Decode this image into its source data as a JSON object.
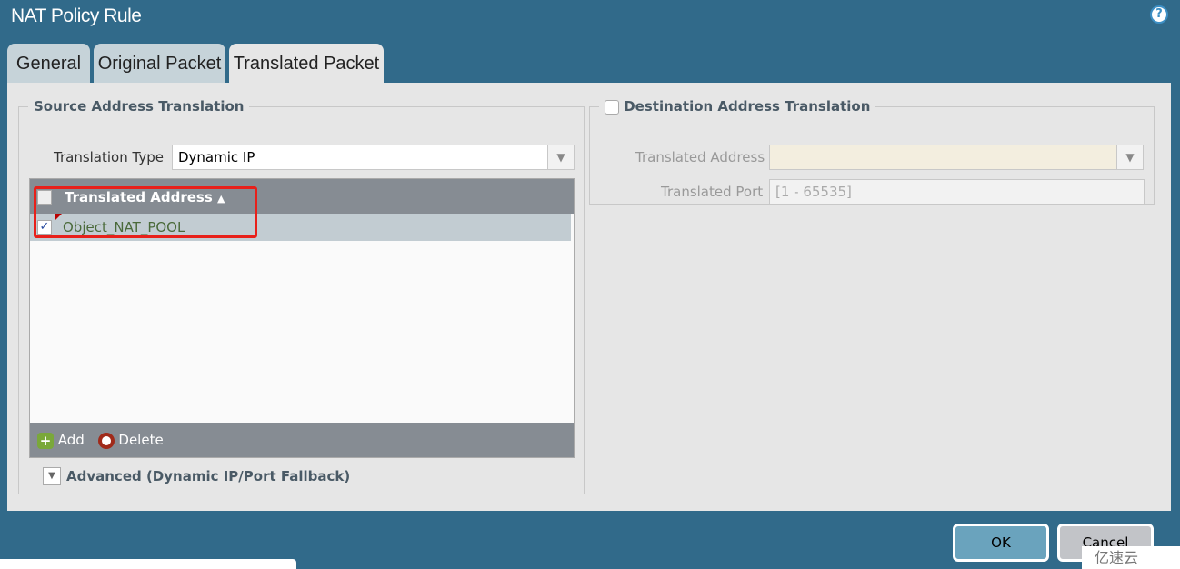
{
  "window": {
    "title": "NAT Policy Rule",
    "help_icon": "question-icon"
  },
  "tabs": [
    {
      "label": "General"
    },
    {
      "label": "Original Packet"
    },
    {
      "label": "Translated Packet",
      "active": true
    }
  ],
  "source": {
    "legend": "Source Address Translation",
    "type_label": "Translation Type",
    "type_value": "Dynamic IP",
    "grid": {
      "header": "Translated Address",
      "sort": "ascending",
      "rows": [
        {
          "value": "Object_NAT_POOL",
          "checked": true
        }
      ],
      "add_label": "Add",
      "delete_label": "Delete"
    },
    "advanced_label": "Advanced (Dynamic IP/Port Fallback)"
  },
  "destination": {
    "legend": "Destination Address Translation",
    "checked": false,
    "address_label": "Translated Address",
    "address_value": "",
    "port_label": "Translated Port",
    "port_placeholder": "[1 - 65535]"
  },
  "buttons": {
    "ok": "OK",
    "cancel": "Cancel"
  },
  "watermark": "亿速云"
}
